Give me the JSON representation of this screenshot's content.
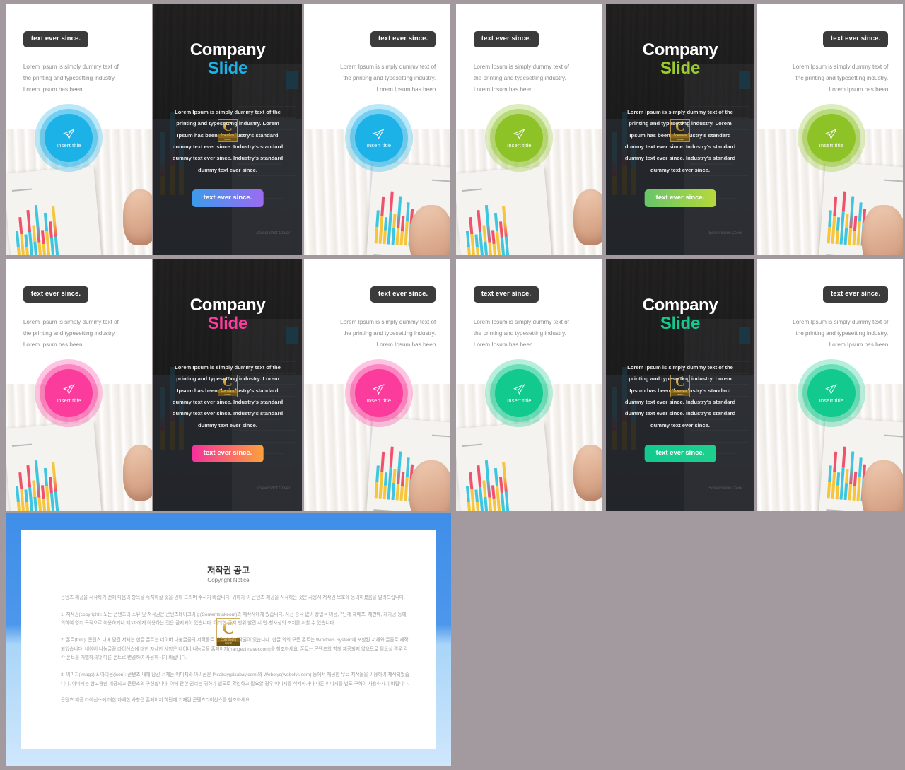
{
  "page": {
    "background_color": "#a39aa0",
    "watermark": {
      "letter": "C",
      "sub": "CONTENTS",
      "note": "MORE"
    }
  },
  "slide_text": {
    "tag_label": "text ever since.",
    "light_body": "Lorem Ipsum is simply dummy text of\nthe printing and typesetting industry.\nLorem Ipsum has been",
    "circle_label": "Insert title",
    "circle_icon": "paper-plane-icon",
    "title_line1": "Company",
    "title_line2": "Slide",
    "dark_body": "Lorem Ipsum is simply dummy text of the printing and typesetting industry.  Lorem Ipsum has been the industry's standard dummy text ever since. Industry's standard dummy text ever since. Industry's standard dummy text ever since.",
    "button_label": "text ever since.",
    "signature": "Screenshot Cover"
  },
  "themes": [
    {
      "name": "blue",
      "accent": "#1CB2E8",
      "title_accent": "#1CB2E8",
      "halo": "#1CB2E8",
      "button_gradient_from": "#3C9BEA",
      "button_gradient_to": "#9B6BF2"
    },
    {
      "name": "green",
      "accent": "#8DC327",
      "title_accent": "#9ACC2E",
      "halo": "#8DC327",
      "button_gradient_from": "#67C56A",
      "button_gradient_to": "#B6D93B"
    },
    {
      "name": "pink",
      "accent": "#FB3C9C",
      "title_accent": "#FB3C9C",
      "halo": "#FB3C9C",
      "button_gradient_from": "#F5319B",
      "button_gradient_to": "#FBA13C"
    },
    {
      "name": "teal",
      "accent": "#12C98E",
      "title_accent": "#12C98E",
      "halo": "#12C98E",
      "button_gradient_from": "#12C98E",
      "button_gradient_to": "#1FCF8E"
    }
  ],
  "copyright": {
    "frame_color_top": "#3F8EE8",
    "frame_color_bottom": "#CFE7FC",
    "title": "저작권 공고",
    "subtitle": "Copyright Notice",
    "paragraphs": [
      "콘텐츠 제공을 시작하기 전에 다음의 항목을 숙지하실 것을 권해 드리며 주시기 바랍니다. 귀하가 이 콘텐츠 제공을 시작하는 것은 사용시 저작권 보호에 동의하셨음을 알려드립니다.",
      "1. 저작권(copyright): 모든 콘텐츠의 소유 및 저작권은 콘텐츠테이크아웃(Contentstakeout)과 제작사에게 있습니다. 사전 승낙 없이 상업적 이용, 7단계 재배포, 재판매, 재가공 등에 의하여 영리 목적으로 이용하거나 제3자에게 이용하는 것은 금지되어 있습니다. 이러한 금지 행위 발견 시 민·형사상의 조치를 취할 수 있습니다.",
      "2. 폰트(font): 콘텐츠 내에 담긴 서체는 한글 폰트는 네이버 나눔글꼴의 저작물로 해당사에 저작권이 있습니다. 한글 외의 모든 폰트는 Windows System에 포함된 서체와 글꼴로 제작되었습니다. 네이버 나눔글꼴 라이선스에 대한 자세한 사항은 네이버 나눔글꼴 홈페이지(hangeul.naver.com)를 참조하세요. 폰트는 콘텐츠의 함께 제공되지 않으므로 필요실 경우 각각 폰트를 개별하셔야 다른 폰트로 변경하여 사용하시기 바랍니다.",
      "3. 이미지(image) & 아이콘(icon): 콘텐츠 내에 담긴 서체는 이미지와 아이콘은 Pixabay(pixabay.com)와 Webolys(webolys.com) 등에서 제공한 무료 저작물을 이용하여 제작되었습니다. 이미지는 참고용만 제공되고 콘텐츠의 구성합니다. 이에 관한 권리는 귀하가 별도로 확인하고 필요할 경우 이미지를 삭제하거나 다른 이미지를 별도 구하여 사용하시기 바랍니다.",
      "콘텐츠 제공 라이선스에 대한 자세한 사항은 홈페이지 하단에 기재된 콘텐츠라이선스를 참조하세요."
    ]
  }
}
